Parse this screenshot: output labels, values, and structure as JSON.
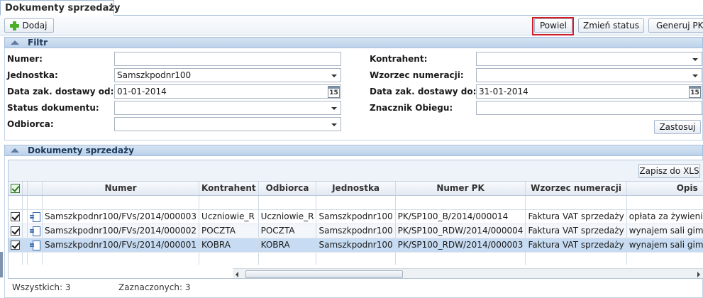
{
  "tab": {
    "title": "Dokumenty sprzedaży"
  },
  "toolbar": {
    "add_label": "Dodaj",
    "duplicate_label": "Powiel",
    "change_status_label": "Zmień status",
    "generate_pk_label": "Generuj PK"
  },
  "filter": {
    "header": "Filtr",
    "numer_label": "Numer:",
    "numer_value": "",
    "jednostka_label": "Jednostka:",
    "jednostka_value": "Samszkpodnr100",
    "data_od_label": "Data zak. dostawy od:",
    "data_od_value": "01-01-2014",
    "status_label": "Status dokumentu:",
    "status_value": "",
    "odbiorca_label": "Odbiorca:",
    "odbiorca_value": "",
    "kontrahent_label": "Kontrahent:",
    "kontrahent_value": "",
    "wzorzec_label": "Wzorzec numeracji:",
    "wzorzec_value": "",
    "data_do_label": "Data zak. dostawy do:",
    "data_do_value": "31-01-2014",
    "znacznik_label": "Znacznik Obiegu:",
    "znacznik_value": "",
    "calendar_day": "15",
    "apply_label": "Zastosuj"
  },
  "grid": {
    "header": "Dokumenty sprzedaży",
    "export_label": "Zapisz do XLS",
    "columns": [
      "Numer",
      "Kontrahent",
      "Odbiorca",
      "Jednostka",
      "Numer PK",
      "Wzorzec numeracji",
      "Opis"
    ],
    "rows": [
      {
        "checked": true,
        "numer": "Samszkpodnr100/FVs/2014/000003",
        "kontrahent": "Uczniowie_R",
        "odbiorca": "Uczniowie_R",
        "jednostka": "Samszkpodnr100",
        "numer_pk": "PK/SP100_B/2014/000014",
        "wzorzec": "Faktura VAT sprzedaży",
        "opis": "opłata za żywienie"
      },
      {
        "checked": true,
        "numer": "Samszkpodnr100/FVs/2014/000002",
        "kontrahent": "POCZTA",
        "odbiorca": "POCZTA",
        "jednostka": "Samszkpodnr100",
        "numer_pk": "PK/SP100_RDW/2014/000004",
        "wzorzec": "Faktura VAT sprzedaży",
        "opis": "wynajem sali gimn"
      },
      {
        "checked": true,
        "numer": "Samszkpodnr100/FVs/2014/000001",
        "kontrahent": "KOBRA",
        "odbiorca": "KOBRA",
        "jednostka": "Samszkpodnr100",
        "numer_pk": "PK/SP100_RDW/2014/000003",
        "wzorzec": "Faktura VAT sprzedaży",
        "opis": "wynajem sali gimn"
      }
    ],
    "selected_row_index": 2
  },
  "footer": {
    "total_label": "Wszystkich: 3",
    "selected_label": "Zaznaczonych: 3"
  },
  "colors": {
    "highlight_border": "#d11f2a",
    "panel_header": "#bcd2ea",
    "selected_row": "#c7dcf2"
  }
}
